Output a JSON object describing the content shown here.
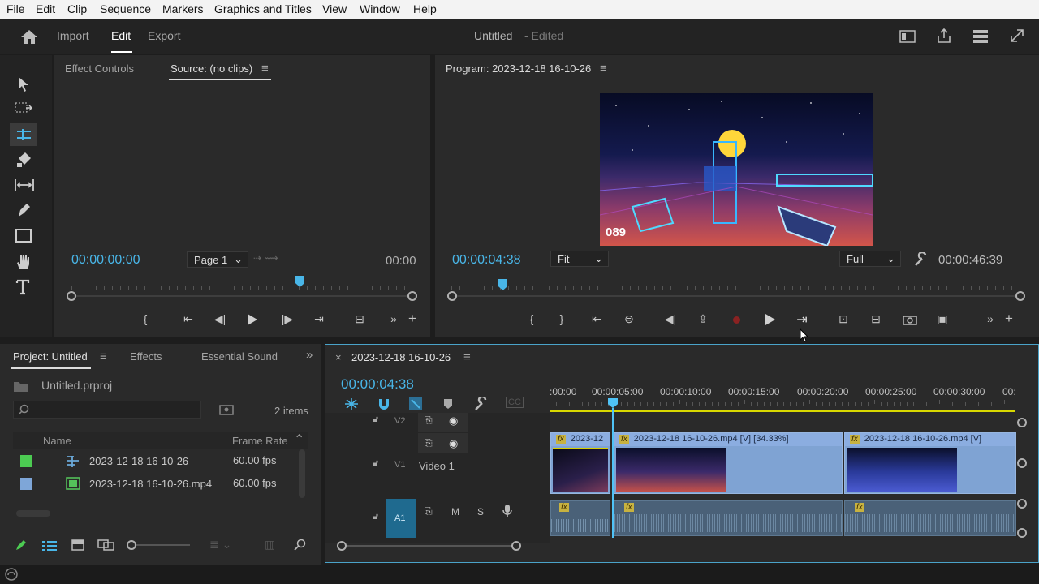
{
  "menu": [
    "File",
    "Edit",
    "Clip",
    "Sequence",
    "Markers",
    "Graphics and Titles",
    "View",
    "Window",
    "Help"
  ],
  "header": {
    "tabs": [
      "Import",
      "Edit",
      "Export"
    ],
    "title": "Untitled",
    "status": "- Edited"
  },
  "source": {
    "tab_effect": "Effect Controls",
    "tab_source": "Source: (no clips)",
    "timecode": "00:00:00:00",
    "page": "Page 1",
    "duration": "00:00"
  },
  "program": {
    "title": "Program: 2023-12-18 16-10-26",
    "timecode": "00:00:04:38",
    "fit": "Fit",
    "quality": "Full",
    "duration": "00:00:46:39",
    "overlay_number": "089"
  },
  "project": {
    "tabs": [
      "Project: Untitled",
      "Effects",
      "Essential Sound"
    ],
    "file": "Untitled.prproj",
    "search_placeholder": "",
    "items_count": "2 items",
    "col_name": "Name",
    "col_framerate": "Frame Rate",
    "rows": [
      {
        "name": "2023-12-18 16-10-26",
        "fps": "60.00 fps",
        "color": "#4ccb52"
      },
      {
        "name": "2023-12-18 16-10-26.mp4",
        "fps": "60.00 fps",
        "color": "#7ea6d8"
      }
    ]
  },
  "timeline": {
    "seq_name": "2023-12-18 16-10-26",
    "timecode": "00:00:04:38",
    "ruler": [
      ":00:00",
      "00:00:05:00",
      "00:00:10:00",
      "00:00:15:00",
      "00:00:20:00",
      "00:00:25:00",
      "00:00:30:00",
      "00:"
    ],
    "tracks": {
      "v2": "V2",
      "v1": "V1",
      "v1_name": "Video 1",
      "a1": "A1",
      "m": "M",
      "s": "S"
    },
    "clips": [
      "2023-12",
      "2023-12-18 16-10-26.mp4 [V] [34.33%]",
      "2023-12-18 16-10-26.mp4 [V]"
    ],
    "fx": "fx"
  },
  "colors": {
    "accent": "#49b6e8",
    "clip": "#7fa3d3",
    "audio": "#4a6178",
    "playhead": "#4fc3f7"
  }
}
